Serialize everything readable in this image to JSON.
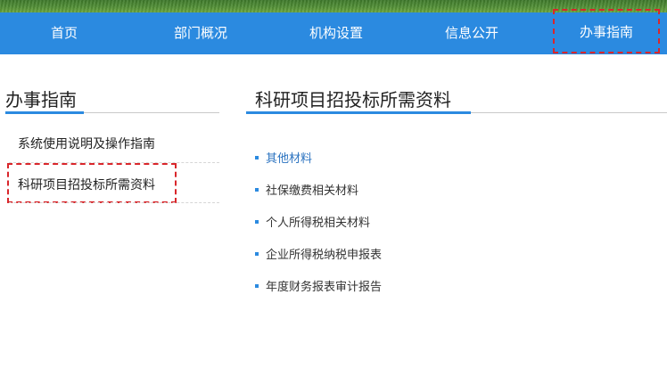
{
  "nav": {
    "items": [
      {
        "label": "首页"
      },
      {
        "label": "部门概况"
      },
      {
        "label": "机构设置"
      },
      {
        "label": "信息公开"
      },
      {
        "label": "办事指南"
      }
    ]
  },
  "sidebar": {
    "title": "办事指南",
    "links": [
      {
        "label": "系统使用说明及操作指南"
      },
      {
        "label": "科研项目招投标所需资料"
      }
    ]
  },
  "main": {
    "title": "科研项目招投标所需资料",
    "items": [
      {
        "label": "其他材料"
      },
      {
        "label": "社保缴费相关材料"
      },
      {
        "label": "个人所得税相关材料"
      },
      {
        "label": "企业所得税纳税申报表"
      },
      {
        "label": "年度财务报表审计报告"
      }
    ]
  },
  "colors": {
    "nav_bg": "#2b8ae0",
    "accent": "#2b8ae0",
    "highlight_border": "#d9262b"
  }
}
